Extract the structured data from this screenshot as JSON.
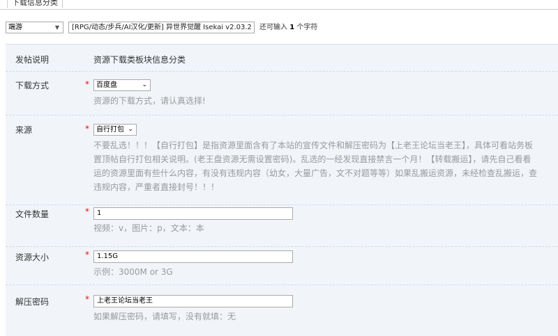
{
  "tab": {
    "label": "下载信息分类"
  },
  "title_row": {
    "type_value": "端游",
    "title_value": "[RPG/动态/步兵/AI汉化/更新] 异世界觉醒 Isekai v2.03.2",
    "remain_prefix": "还可输入",
    "remain_count": "1",
    "remain_suffix": "个字符"
  },
  "form": {
    "post_desc": {
      "label": "发帖说明",
      "text": "资源下载类板块信息分类"
    },
    "download_method": {
      "label": "下载方式",
      "value": "百度盘",
      "tip": "资源的下载方式，请认真选择!"
    },
    "source": {
      "label": "来源",
      "value": "自行打包",
      "tip_lines": [
        "不要乱选！！！【自行打包】是指资源里面含有了本站的宣传文件和解压密码为【上老王论坛当老王】，具体可看站务板",
        "置顶帖自行打包相关说明。(老王盘资源无需设置密码)。乱选的一经发现直接禁言一个月！【转载搬运】，请先自己看看",
        "运的资源里面有些什么内容，有没有违规内容（幼女，大量广告，文不对题等等）如果乱搬运资源，未经检查乱搬运，查",
        "违规内容，严重者直接封号！！！"
      ]
    },
    "file_count": {
      "label": "文件数量",
      "value": "1",
      "tip": "视频：v，图片：p，文本：本"
    },
    "resource_size": {
      "label": "资源大小",
      "value": "1.15G",
      "tip": "示例：3000M or 3G"
    },
    "unzip_password": {
      "label": "解压密码",
      "value": "上老王论坛当老王",
      "tip": "如果解压密码，请填写，没有就填：无"
    }
  },
  "required_mark": "*",
  "colors": {
    "required": "#ff0000",
    "panel_bg": "#f1f5fa",
    "tip": "#999999"
  }
}
